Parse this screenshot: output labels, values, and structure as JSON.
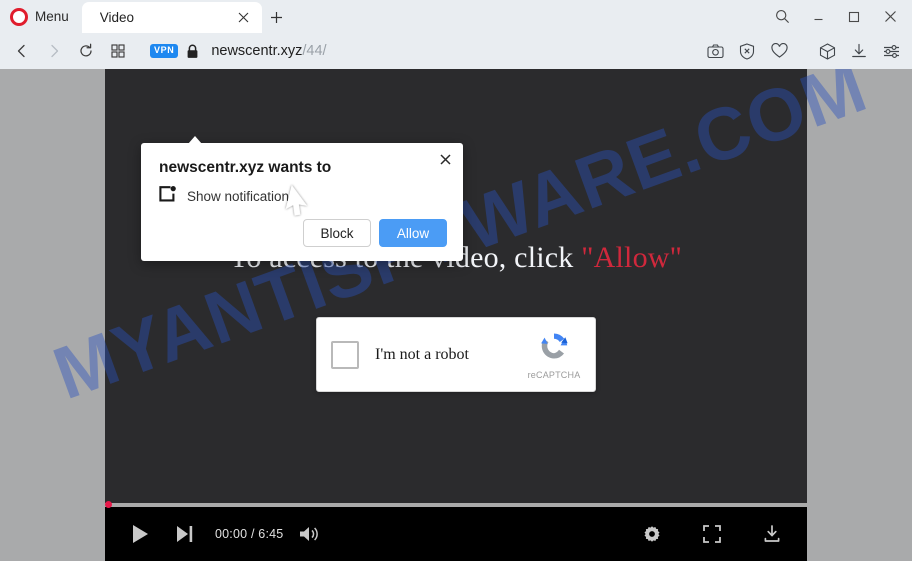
{
  "browser": {
    "menu_label": "Menu",
    "logo_name": "opera-logo",
    "tab": {
      "title": "Video",
      "close_label": "×"
    },
    "new_tab_label": "+",
    "window_controls": {
      "search": "search-icon",
      "minimize": "–",
      "maximize": "□",
      "close": "×"
    },
    "address": {
      "vpn_badge": "VPN",
      "domain": "newscentr.xyz",
      "path": "/44/",
      "full_url": "newscentr.xyz/44/"
    },
    "nav": {
      "back": "back-icon",
      "forward": "forward-icon",
      "reload": "reload-icon",
      "speeddial": "speed-dial-icon"
    },
    "toolbar_icons": [
      "snapshot-icon",
      "ad-blocker-icon",
      "heart-icon",
      "crypto-wallet-icon",
      "downloads-icon",
      "easy-setup-icon"
    ]
  },
  "notification_dialog": {
    "title": "newscentr.xyz wants to",
    "permission": "Show notifications",
    "icon": "notification-permission-icon",
    "block_label": "Block",
    "allow_label": "Allow",
    "close_label": "×"
  },
  "page": {
    "headline_prefix": "To access to the video, click ",
    "headline_allow": "\"Allow\"",
    "accent_red": "#d0283c",
    "background": "#2b2b2d",
    "captcha": {
      "label": "I'm not a robot",
      "brand": "reCAPTCHA"
    },
    "watermark": "MYANTISPYWARE.COM"
  },
  "player": {
    "play_label": "play-icon",
    "next_label": "next-icon",
    "time": "00:00 / 6:45",
    "current_time": "00:00",
    "duration": "6:45",
    "volume_label": "volume-icon",
    "settings_label": "settings-icon",
    "fullscreen_label": "fullscreen-icon",
    "download_label": "download-icon",
    "progress_percent": 0
  }
}
